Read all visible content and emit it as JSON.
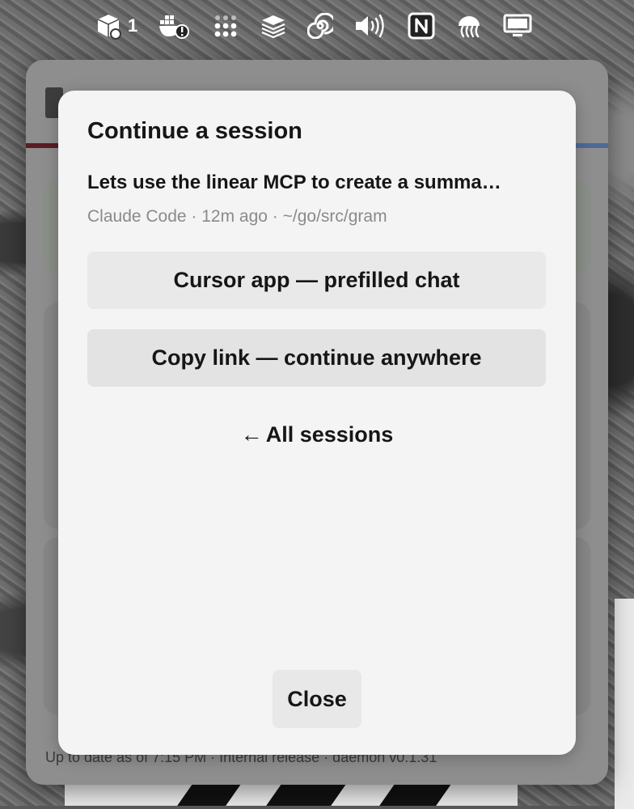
{
  "menubar": {
    "box_count": "1",
    "icons": [
      "box-icon",
      "docker-warning-icon",
      "dots-grid-icon",
      "stack-icon",
      "spiral-icon",
      "volume-icon",
      "notion-icon",
      "jellyfish-icon",
      "display-icon"
    ]
  },
  "background": {
    "footer": "Up to date as of 7:15 PM · Internal release · daemon v0.1.31"
  },
  "dialog": {
    "title": "Continue a session",
    "session_title": "Lets use the linear MCP to create a summa…",
    "session_meta": "Claude Code · 12m ago · ~/go/src/gram",
    "cursor_button": "Cursor app — prefilled chat",
    "copy_button": "Copy link — continue anywhere",
    "back_arrow": "←",
    "back_label": "All sessions",
    "close_button": "Close"
  }
}
